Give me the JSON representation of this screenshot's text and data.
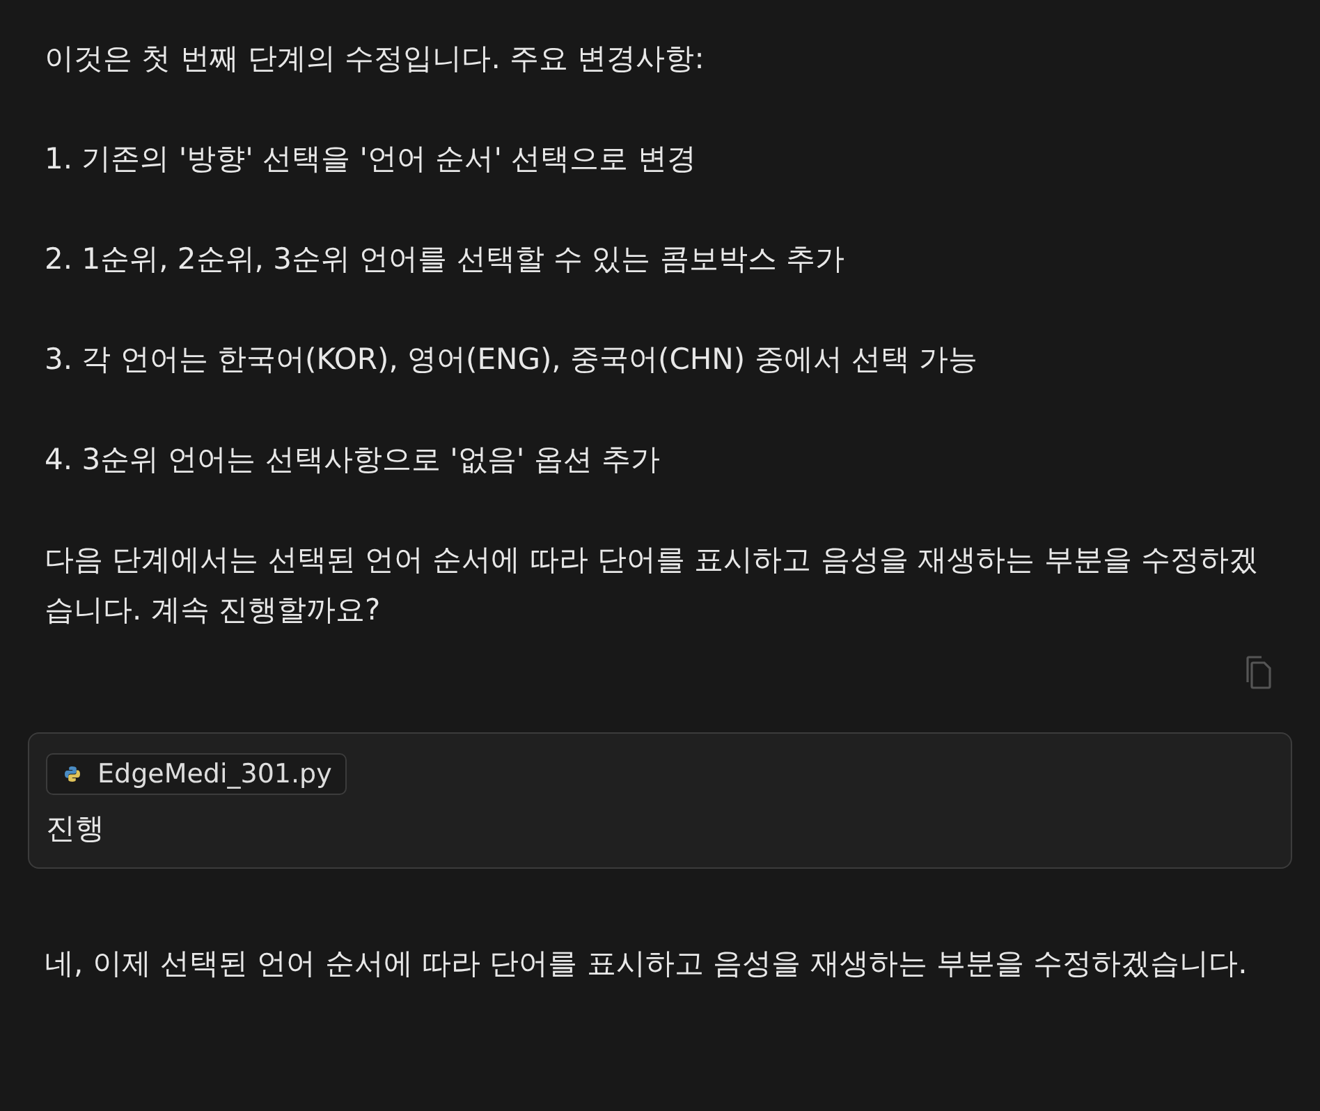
{
  "assistant_message": {
    "intro": "이것은 첫 번째 단계의 수정입니다. 주요 변경사항:",
    "items": [
      "1. 기존의 '방향' 선택을 '언어 순서' 선택으로 변경",
      "2. 1순위, 2순위, 3순위 언어를 선택할 수 있는 콤보박스 추가",
      "3. 각 언어는 한국어(KOR), 영어(ENG), 중국어(CHN) 중에서 선택 가능",
      "4. 3순위 언어는 선택사항으로 '없음' 옵션 추가"
    ],
    "closing": "다음 단계에서는 선택된 언어 순서에 따라 단어를 표시하고 음성을 재생하는 부분을 수정하겠습니다. 계속 진행할까요?"
  },
  "user_message": {
    "attachment": "EdgeMedi_301.py",
    "text": "진행"
  },
  "reply": {
    "text": "네, 이제 선택된 언어 순서에 따라 단어를 표시하고 음성을 재생하는 부분을 수정하겠습니다."
  }
}
